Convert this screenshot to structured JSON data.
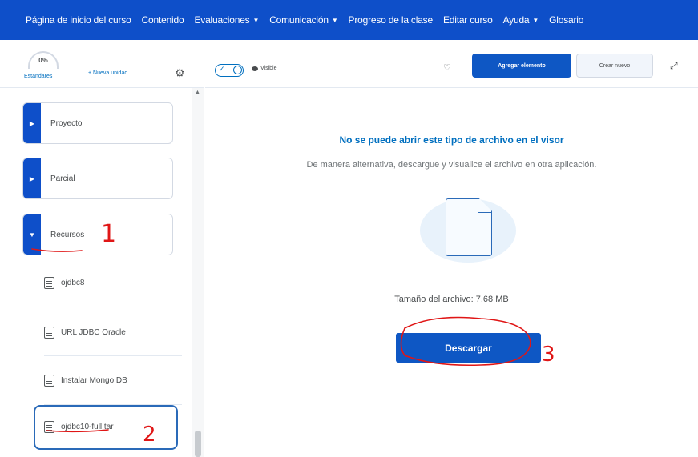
{
  "navbar": {
    "items": [
      {
        "label": "Página de inicio del curso",
        "dropdown": false
      },
      {
        "label": "Contenido",
        "dropdown": false
      },
      {
        "label": "Evaluaciones",
        "dropdown": true
      },
      {
        "label": "Comunicación",
        "dropdown": true
      },
      {
        "label": "Progreso de la clase",
        "dropdown": false
      },
      {
        "label": "Editar curso",
        "dropdown": false
      },
      {
        "label": "Ayuda",
        "dropdown": true
      },
      {
        "label": "Glosario",
        "dropdown": false
      }
    ],
    "color": "#0e4fc9"
  },
  "sidebar": {
    "progress_value": "0%",
    "progress_label": "Estándares",
    "new_unit_label": "+ Nueva unidad",
    "units": [
      {
        "label": "Proyecto",
        "expanded": false
      },
      {
        "label": "Parcial",
        "expanded": false
      },
      {
        "label": "Recursos",
        "expanded": true
      }
    ],
    "topics": [
      {
        "label": "ojdbc8"
      },
      {
        "label": "URL JDBC Oracle"
      },
      {
        "label": "Instalar Mongo DB"
      },
      {
        "label": "ojdbc10-full.tar",
        "selected": true
      }
    ]
  },
  "toolbar": {
    "visibility_label": "Visible",
    "add_button": "Agregar elemento",
    "create_button": "Crear nuevo"
  },
  "viewer": {
    "title": "No se puede abrir este tipo de archivo en el visor",
    "subtitle": "De manera alternativa, descargue y visualice el archivo en otra aplicación.",
    "file_size": "Tamaño del archivo: 7.68 MB",
    "download_button": "Descargar"
  },
  "annotations": {
    "marks": [
      "1",
      "2",
      "3"
    ],
    "ink_color": "#e01616"
  }
}
